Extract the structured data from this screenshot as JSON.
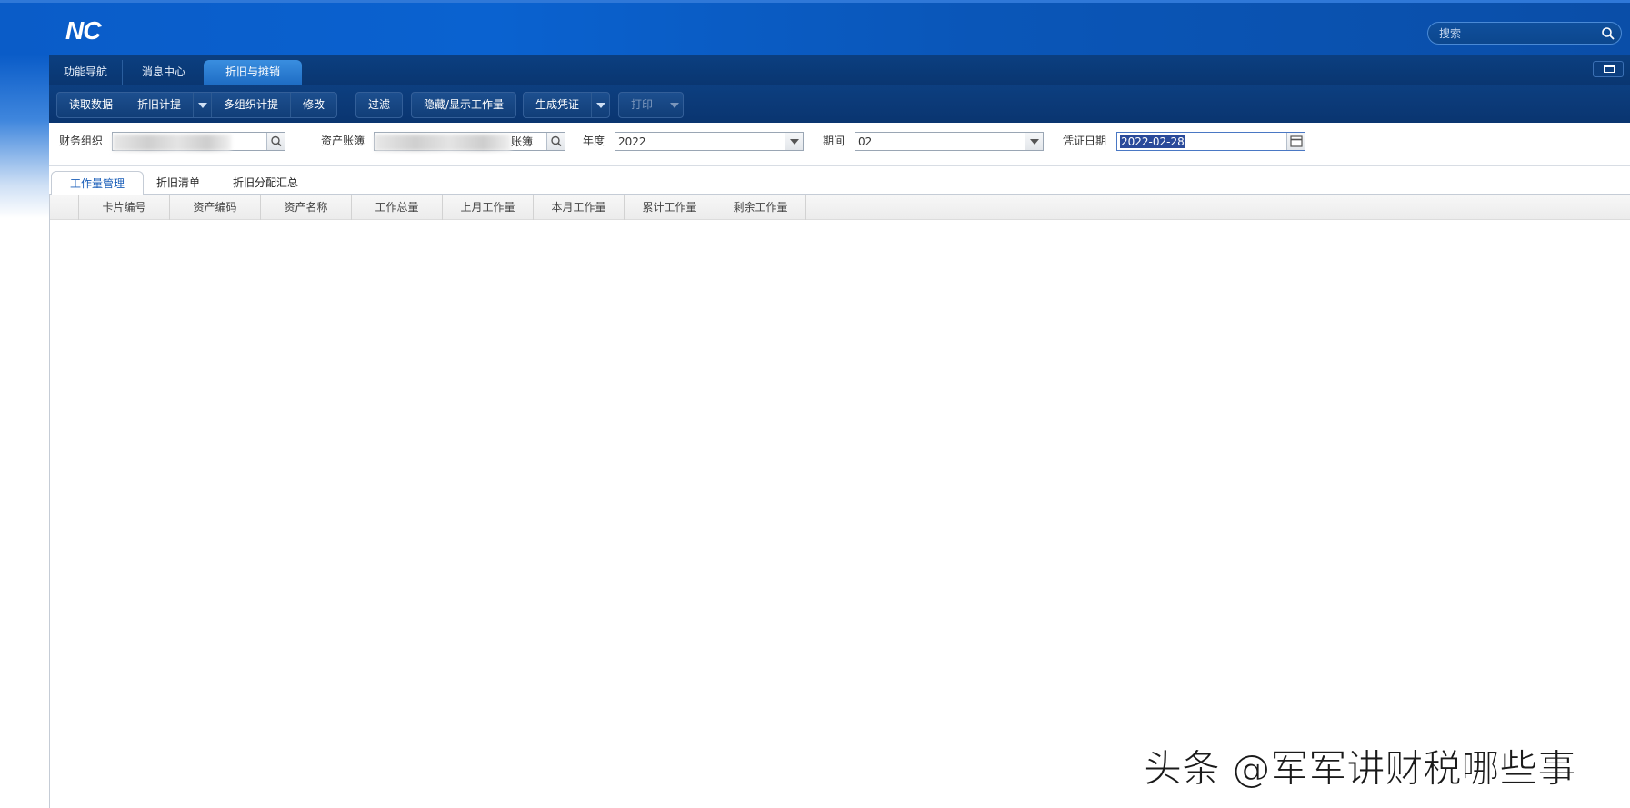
{
  "app": {
    "logo": "NC"
  },
  "header": {
    "search_placeholder": "搜索"
  },
  "nav": {
    "tabs": [
      {
        "label": "功能导航"
      },
      {
        "label": "消息中心"
      },
      {
        "label": "折旧与摊销"
      }
    ]
  },
  "toolbar": {
    "read_data": "读取数据",
    "depreciation": "折旧计提",
    "multi_org_depreciation": "多组织计提",
    "modify": "修改",
    "filter": "过滤",
    "toggle_workload": "隐藏/显示工作量",
    "generate_voucher": "生成凭证",
    "print": "打印"
  },
  "form": {
    "finance_org_label": "财务组织",
    "asset_book_label": "资产账簿",
    "asset_book_suffix": "账簿",
    "year_label": "年度",
    "year_value": "2022",
    "period_label": "期间",
    "period_value": "02",
    "voucher_date_label": "凭证日期",
    "voucher_date_value": "2022-02-28"
  },
  "content_tabs": [
    {
      "label": "工作量管理"
    },
    {
      "label": "折旧清单"
    },
    {
      "label": "折旧分配汇总"
    }
  ],
  "grid": {
    "columns": [
      "卡片编号",
      "资产编码",
      "资产名称",
      "工作总量",
      "上月工作量",
      "本月工作量",
      "累计工作量",
      "剩余工作量"
    ],
    "rows": []
  },
  "watermark": "头条 @军军讲财税哪些事",
  "colors": {
    "header_blue": "#0a5cc8",
    "toolbar_navy": "#0a3570",
    "active_tab_blue": "#1a5eb8"
  }
}
